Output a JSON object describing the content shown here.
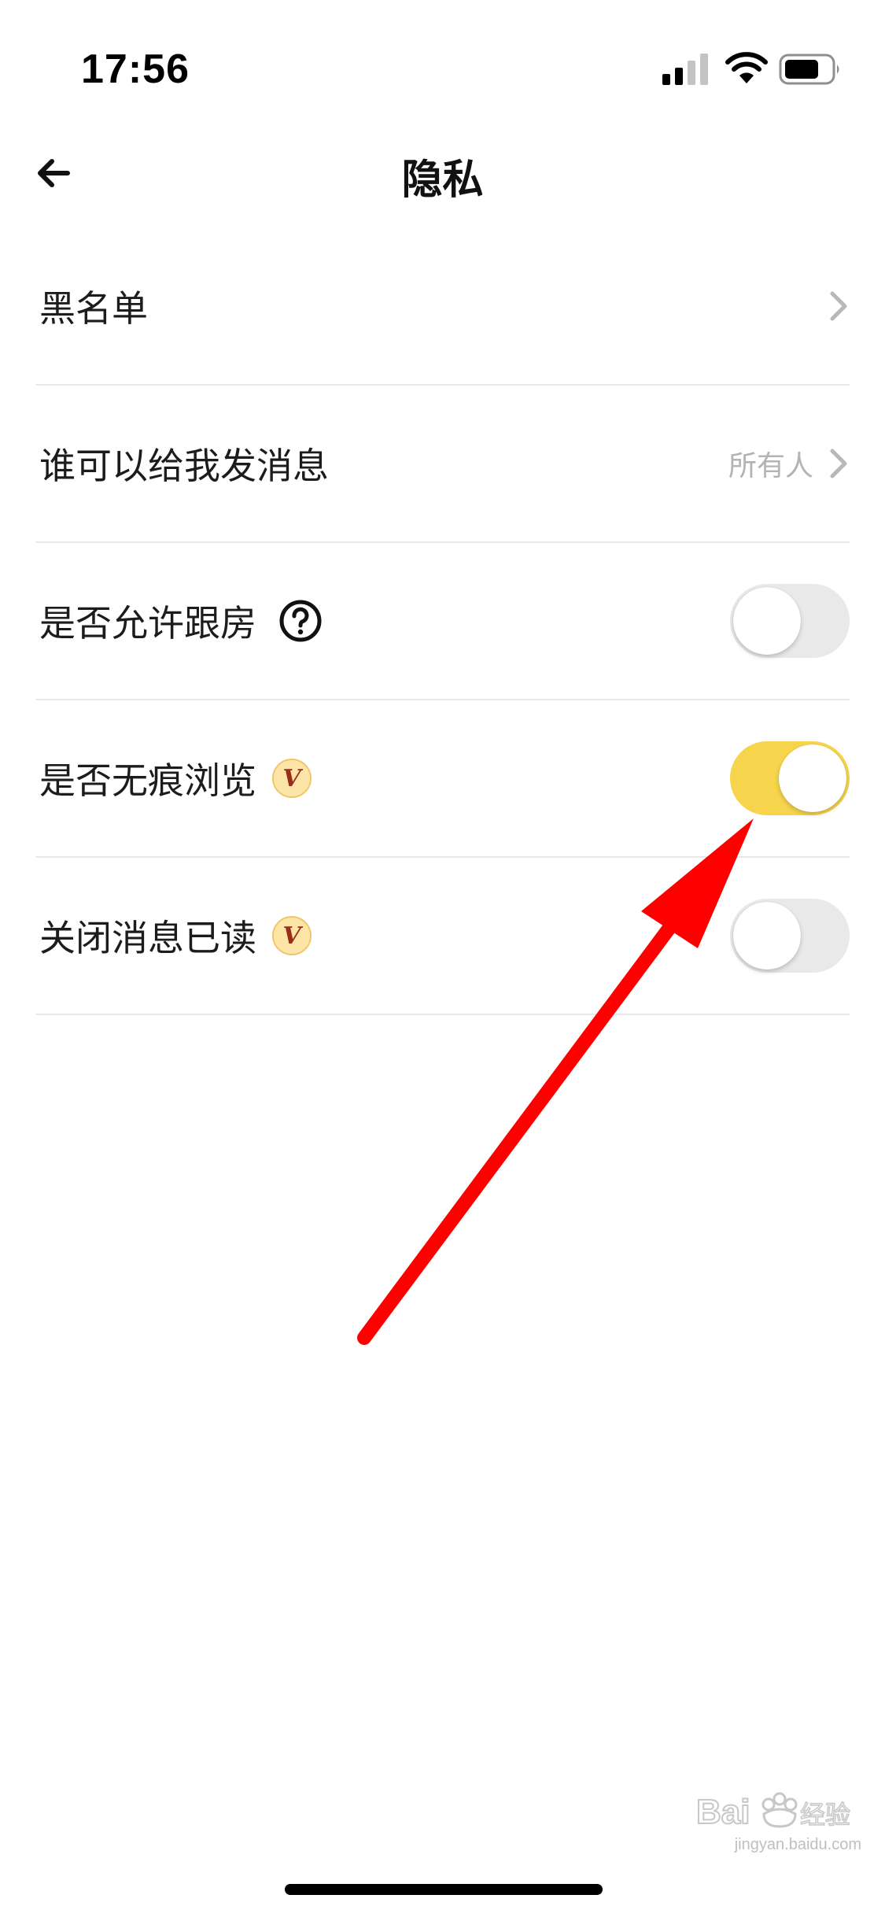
{
  "status_bar": {
    "time": "17:56",
    "icons": [
      "signal-icon",
      "wifi-icon",
      "battery-icon"
    ]
  },
  "nav": {
    "title": "隐私",
    "back_icon": "back-arrow-icon"
  },
  "settings": {
    "blacklist": {
      "label": "黑名单",
      "icon": "chevron-right-icon"
    },
    "who_can_message": {
      "label": "谁可以给我发消息",
      "value": "所有人",
      "icon": "chevron-right-icon"
    },
    "allow_follow_room": {
      "label": "是否允许跟房",
      "help_icon": "help-icon",
      "enabled": false
    },
    "incognito_browse": {
      "label": "是否无痕浏览",
      "badge": "V",
      "enabled": true
    },
    "hide_read_receipt": {
      "label": "关闭消息已读",
      "badge": "V",
      "enabled": false
    }
  },
  "colors": {
    "toggle_on": "#f6d44c",
    "toggle_off": "#e9e9ea",
    "annotation_arrow": "#ff0000",
    "vip_badge_bg": "#fde5a8",
    "vip_badge_text": "#9a2c1a"
  },
  "watermark": {
    "logo": "Bai du 经验",
    "url": "jingyan.baidu.com"
  }
}
